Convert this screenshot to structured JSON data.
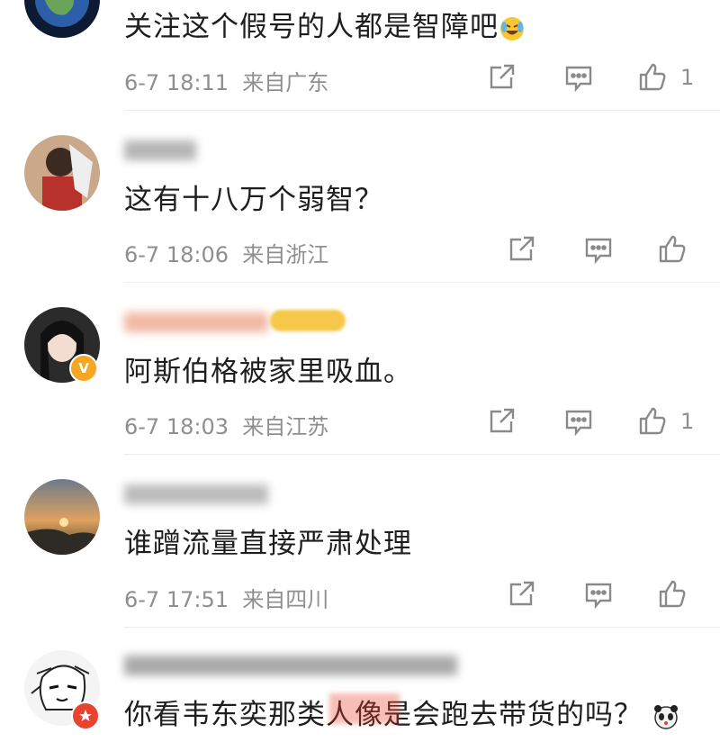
{
  "comments": [
    {
      "username": "",
      "text": "关注这个假号的人都是智障吧",
      "emoji": "laugh-cry-emoji",
      "date": "6-7 18:11",
      "location": "来自广东",
      "likes": "1"
    },
    {
      "username": "",
      "text": "这有十八万个弱智？",
      "date": "6-7 18:06",
      "location": "来自浙江",
      "likes": ""
    },
    {
      "username": "",
      "text": "阿斯伯格被家里吸血。",
      "date": "6-7 18:03",
      "location": "来自江苏",
      "likes": "1",
      "verified_badge": "V"
    },
    {
      "username": "",
      "text": "谁蹭流量直接严肃处理",
      "date": "6-7 17:51",
      "location": "来自四川",
      "likes": ""
    },
    {
      "username": "",
      "text": "你看韦东奕那类人像是会跑去带货的吗？",
      "emoji": "panda-emoji",
      "date": "",
      "location": "",
      "likes": ""
    }
  ],
  "colors": {
    "meta_gray": "#8f8f8f",
    "icon_gray": "#8a8a8a",
    "badge_orange": "#f5a623",
    "badge_red": "#e8432e",
    "divider": "#ececec"
  }
}
